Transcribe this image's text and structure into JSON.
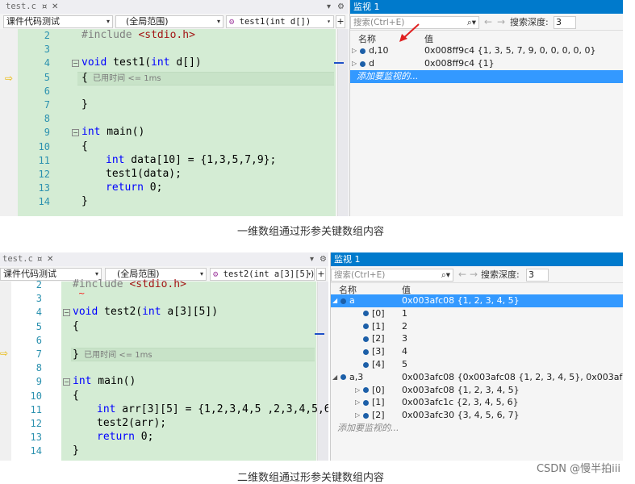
{
  "panel1": {
    "tab": "test.c",
    "scope_left": "课件代码测试",
    "scope_mid": "(全局范围)",
    "scope_right": "test1(int d[])",
    "lines": [
      {
        "n": "2",
        "t": "#include <stdio.h>"
      },
      {
        "n": "3",
        "t": ""
      },
      {
        "n": "4",
        "t": "void test1(int d[])"
      },
      {
        "n": "5",
        "t": "{",
        "perf": "已用时间 <= 1ms"
      },
      {
        "n": "6",
        "t": ""
      },
      {
        "n": "7",
        "t": "}"
      },
      {
        "n": "8",
        "t": ""
      },
      {
        "n": "9",
        "t": "int main()"
      },
      {
        "n": "10",
        "t": "{"
      },
      {
        "n": "11",
        "t": "int data[10] = {1,3,5,7,9};"
      },
      {
        "n": "12",
        "t": "test1(data);"
      },
      {
        "n": "13",
        "t": "return 0;"
      },
      {
        "n": "14",
        "t": "}"
      }
    ],
    "watch": {
      "title": "监视 1",
      "search_placeholder": "搜索(Ctrl+E)",
      "depth_label": "搜索深度:",
      "depth_value": "3",
      "col_name": "名称",
      "col_value": "值",
      "rows": [
        {
          "name": "d,10",
          "value": "0x008ff9c4 {1, 3, 5, 7, 9, 0, 0, 0, 0, 0}"
        },
        {
          "name": "d",
          "value": "0x008ff9c4 {1}"
        }
      ],
      "add_text": "添加要监视的..."
    },
    "caption": "一维数组通过形参关键数组内容"
  },
  "panel2": {
    "tab": "test.c",
    "scope_left": "课件代码测试",
    "scope_mid": "(全局范围)",
    "scope_right": "test2(int a[3][5])",
    "lines": [
      {
        "n": "2",
        "t": "#include <stdio.h>"
      },
      {
        "n": "3",
        "t": ""
      },
      {
        "n": "4",
        "t": "void test2(int a[3][5])"
      },
      {
        "n": "5",
        "t": "{"
      },
      {
        "n": "6",
        "t": ""
      },
      {
        "n": "7",
        "t": "}",
        "perf": "已用时间 <= 1ms"
      },
      {
        "n": "8",
        "t": ""
      },
      {
        "n": "9",
        "t": "int main()"
      },
      {
        "n": "10",
        "t": "{"
      },
      {
        "n": "11",
        "t": "int arr[3][5] = {1,2,3,4,5 ,2,3,4,5,6"
      },
      {
        "n": "12",
        "t": "test2(arr);"
      },
      {
        "n": "13",
        "t": "return 0;"
      },
      {
        "n": "14",
        "t": "}"
      }
    ],
    "watch": {
      "title": "监视 1",
      "search_placeholder": "搜索(Ctrl+E)",
      "depth_label": "搜索深度:",
      "depth_value": "3",
      "col_name": "名称",
      "col_value": "值",
      "rows": [
        {
          "name": "a",
          "value": "0x003afc08 {1, 2, 3, 4, 5}"
        },
        {
          "name": "[0]",
          "value": "1"
        },
        {
          "name": "[1]",
          "value": "2"
        },
        {
          "name": "[2]",
          "value": "3"
        },
        {
          "name": "[3]",
          "value": "4"
        },
        {
          "name": "[4]",
          "value": "5"
        },
        {
          "name": "a,3",
          "value": "0x003afc08 {0x003afc08 {1, 2, 3, 4, 5}, 0x003afc1c {2, 3, 4"
        },
        {
          "name": "[0]",
          "value": "0x003afc08 {1, 2, 3, 4, 5}"
        },
        {
          "name": "[1]",
          "value": "0x003afc1c {2, 3, 4, 5, 6}"
        },
        {
          "name": "[2]",
          "value": "0x003afc30 {3, 4, 5, 6, 7}"
        }
      ],
      "add_text": "添加要监视的..."
    },
    "caption": "二维数组通过形参关键数组内容"
  },
  "watermark": "CSDN @慢半拍iii",
  "colors": {
    "code_bg": "#d4ecd4",
    "watch_header": "#007acc",
    "selection": "#3399ff"
  }
}
